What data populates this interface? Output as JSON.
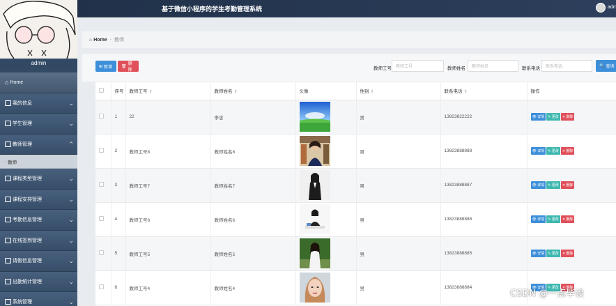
{
  "header": {
    "title": "基于微信小程序的学生考勤管理系统",
    "user": "admin"
  },
  "sidebar": {
    "username": "admin",
    "items": [
      {
        "label": "Home",
        "icon": "home-icon"
      },
      {
        "label": "我的信息",
        "icon": "profile-icon"
      },
      {
        "label": "学生管理",
        "icon": "student-icon"
      },
      {
        "label": "教师管理",
        "icon": "teacher-icon",
        "expanded": true
      },
      {
        "label": "课程类型管理",
        "icon": "grid-icon"
      },
      {
        "label": "课程安排管理",
        "icon": "grid-icon"
      },
      {
        "label": "考勤信息管理",
        "icon": "clipboard-icon"
      },
      {
        "label": "在线签到管理",
        "icon": "grid-icon"
      },
      {
        "label": "请假信息管理",
        "icon": "grid-icon"
      },
      {
        "label": "出勤统计管理",
        "icon": "grid-icon"
      },
      {
        "label": "系统管理",
        "icon": "grid-icon"
      }
    ],
    "sub_item": "教师"
  },
  "breadcrumb": {
    "home": "Home",
    "current": "教师"
  },
  "toolbar": {
    "add_label": "新增",
    "delete_label": "删除",
    "search_label": "查询",
    "filters": [
      {
        "label": "教师工号",
        "placeholder": "教师工号"
      },
      {
        "label": "教师姓名",
        "placeholder": "教师姓名"
      },
      {
        "label": "联系电话",
        "placeholder": "联系电话"
      }
    ]
  },
  "table": {
    "columns": [
      "序号",
      "教师工号",
      "教师姓名",
      "头像",
      "性别",
      "联系电话",
      "操作"
    ],
    "ops": {
      "view": "详情",
      "edit": "更改",
      "delete": "删除"
    },
    "rows": [
      {
        "index": "1",
        "id": "22",
        "name": "李忠",
        "gender": "男",
        "phone": "13823822222",
        "photo": "landscape"
      },
      {
        "index": "2",
        "id": "教师工号8",
        "name": "教师姓名8",
        "gender": "男",
        "phone": "13823888888",
        "photo": "woman-shelf"
      },
      {
        "index": "3",
        "id": "教师工号7",
        "name": "教师姓名7",
        "gender": "男",
        "phone": "13823888887",
        "photo": "woman-suit"
      },
      {
        "index": "4",
        "id": "教师工号6",
        "name": "教师姓名6",
        "gender": "男",
        "phone": "13823888886",
        "photo": "woman-desk"
      },
      {
        "index": "5",
        "id": "教师工号5",
        "name": "教师姓名5",
        "gender": "男",
        "phone": "13823888885",
        "photo": "woman-outdoor"
      },
      {
        "index": "6",
        "id": "教师工号4",
        "name": "教师姓名4",
        "gender": "男",
        "phone": "13823888884",
        "photo": "woman-portrait"
      }
    ]
  },
  "watermark": "CSDN @一点毕设"
}
